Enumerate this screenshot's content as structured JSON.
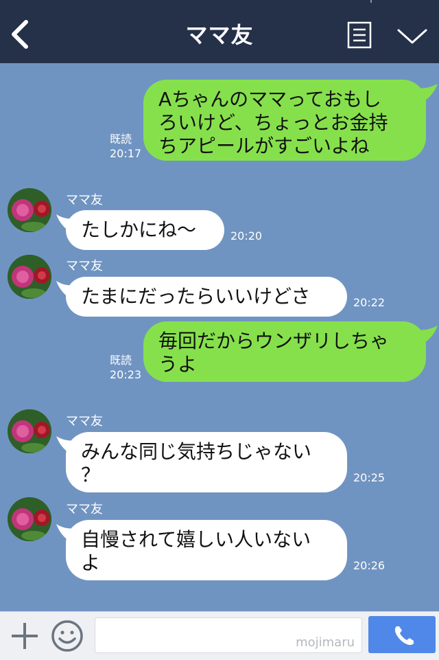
{
  "header": {
    "title": "ママ友",
    "back_icon": "chevron-left-icon",
    "menu_icon": "menu-icon",
    "expand_icon": "chevron-down-icon",
    "background": "#253049"
  },
  "chat": {
    "background": "#7094c1",
    "sent_color": "#86e04c",
    "received_color": "#ffffff",
    "messages": [
      {
        "from": "self",
        "lines": [
          "Aちゃんのママっておもし",
          "ろいけど、ちょっとお金持",
          "ちアピールがすごいよね"
        ],
        "read_label": "既読",
        "time": "20:17"
      },
      {
        "from": "friend",
        "sender": "ママ友",
        "lines": [
          "たしかにね〜"
        ],
        "time": "20:20"
      },
      {
        "from": "friend",
        "sender": "ママ友",
        "lines": [
          "たまにだったらいいけどさ"
        ],
        "time": "20:22"
      },
      {
        "from": "self",
        "lines": [
          "毎回だからウンザリしちゃ",
          "うよ"
        ],
        "read_label": "既読",
        "time": "20:23"
      },
      {
        "from": "friend",
        "sender": "ママ友",
        "lines": [
          "みんな同じ気持ちじゃない",
          "？"
        ],
        "time": "20:25"
      },
      {
        "from": "friend",
        "sender": "ママ友",
        "lines": [
          "自慢されて嬉しい人いない",
          "よ"
        ],
        "time": "20:26"
      }
    ]
  },
  "footer": {
    "plus_icon": "plus-icon",
    "emoji_icon": "smiley-icon",
    "input_value": "",
    "watermark": "mojimaru",
    "call_icon": "phone-icon",
    "call_color": "#4f88e8"
  }
}
